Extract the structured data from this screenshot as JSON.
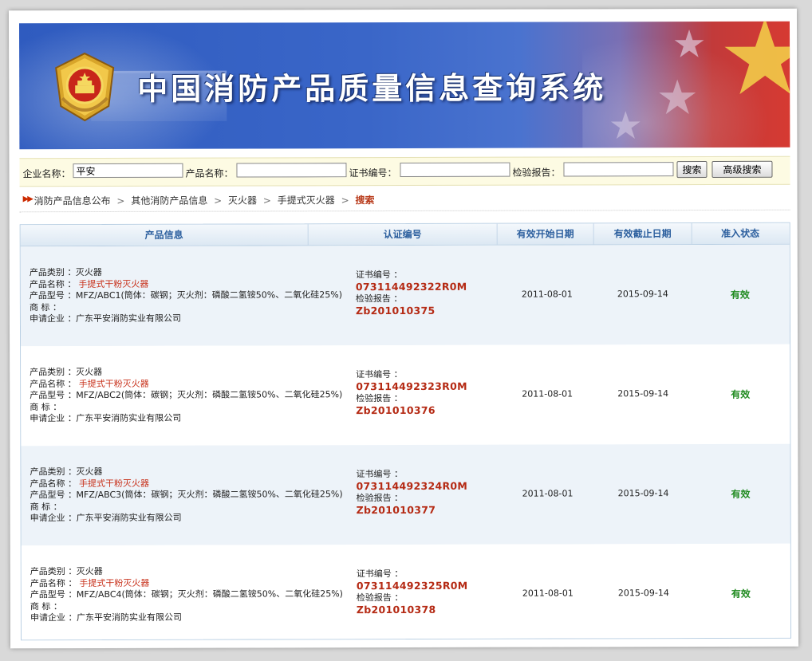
{
  "banner": {
    "title": "中国消防产品质量信息查询系统"
  },
  "search": {
    "company_label": "企业名称：",
    "company_value": "平安",
    "product_label": "产品名称：",
    "product_value": "",
    "cert_label": "证书编号：",
    "cert_value": "",
    "report_label": "检验报告：",
    "report_value": "",
    "search_button": "搜索",
    "advanced_button": "高级搜索"
  },
  "breadcrumb": {
    "items": [
      "消防产品信息公布",
      "其他消防产品信息",
      "灭火器",
      "手提式灭火器"
    ],
    "current": "搜索",
    "separator": ">"
  },
  "table": {
    "headers": [
      "产品信息",
      "认证编号",
      "有效开始日期",
      "有效截止日期",
      "准入状态"
    ],
    "field_labels": {
      "category": "产品类别 ：",
      "name": "产品名称 ：",
      "model": "产品型号 ：",
      "trademark": "商    标 ：",
      "applicant": "申请企业 ："
    },
    "cert_labels": {
      "cert": "证书编号 ：",
      "report": "检验报告 ："
    },
    "rows": [
      {
        "category": "灭火器",
        "name": "手提式干粉灭火器",
        "model": "MFZ/ABC1(筒体：碳钢；灭火剂：磷酸二氢铵50%、二氧化硅25%)",
        "trademark": "",
        "applicant": "广东平安消防实业有限公司",
        "cert_no": "073114492322R0M",
        "report_no": "Zb201010375",
        "start": "2011-08-01",
        "end": "2015-09-14",
        "status": "有效"
      },
      {
        "category": "灭火器",
        "name": "手提式干粉灭火器",
        "model": "MFZ/ABC2(筒体：碳钢；灭火剂：磷酸二氢铵50%、二氧化硅25%)",
        "trademark": "",
        "applicant": "广东平安消防实业有限公司",
        "cert_no": "073114492323R0M",
        "report_no": "Zb201010376",
        "start": "2011-08-01",
        "end": "2015-09-14",
        "status": "有效"
      },
      {
        "category": "灭火器",
        "name": "手提式干粉灭火器",
        "model": "MFZ/ABC3(筒体：碳钢；灭火剂：磷酸二氢铵50%、二氧化硅25%)",
        "trademark": "",
        "applicant": "广东平安消防实业有限公司",
        "cert_no": "073114492324R0M",
        "report_no": "Zb201010377",
        "start": "2011-08-01",
        "end": "2015-09-14",
        "status": "有效"
      },
      {
        "category": "灭火器",
        "name": "手提式干粉灭火器",
        "model": "MFZ/ABC4(筒体：碳钢；灭火剂：磷酸二氢铵50%、二氧化硅25%)",
        "trademark": "",
        "applicant": "广东平安消防实业有限公司",
        "cert_no": "073114492325R0M",
        "report_no": "Zb201010378",
        "start": "2011-08-01",
        "end": "2015-09-14",
        "status": "有效"
      }
    ]
  },
  "colors": {
    "banner_blue": "#3a66c8",
    "flag_red": "#d63a32",
    "header_text": "#2c5f9e",
    "code_red": "#b52a14",
    "status_green": "#1f8a1f"
  }
}
